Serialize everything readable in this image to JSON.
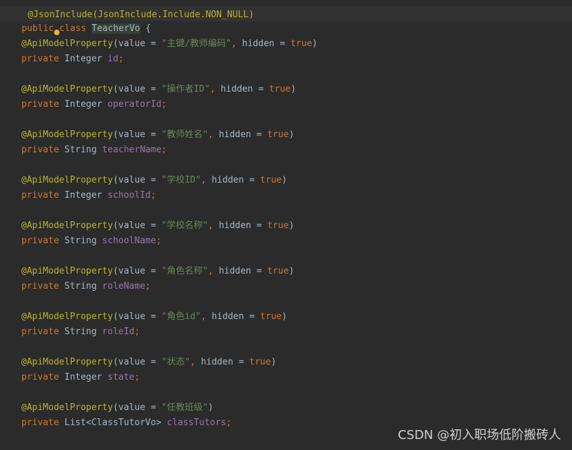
{
  "editor": {
    "top_partial": "@JsonInclude(JsonInclude.Include.NON_NULL)",
    "class_line": {
      "modifiers": "public class ",
      "class_name": "TeacherVo",
      "brace": " {"
    },
    "fields": [
      {
        "annotation": "@ApiModelProperty",
        "value_key": "(value = ",
        "value": "\"主键/教师编码\"",
        "hidden_part": ", hidden = ",
        "hidden": "true",
        "close": ")",
        "modifier": "private ",
        "type": "Integer",
        "name": "id"
      },
      {
        "annotation": "@ApiModelProperty",
        "value_key": "(value = ",
        "value": "\"操作者ID\"",
        "hidden_part": ", hidden = ",
        "hidden": "true",
        "close": ")",
        "modifier": "private ",
        "type": "Integer",
        "name": "operatorId"
      },
      {
        "annotation": "@ApiModelProperty",
        "value_key": "(value = ",
        "value": "\"教师姓名\"",
        "hidden_part": ", hidden = ",
        "hidden": "true",
        "close": ")",
        "modifier": "private ",
        "type": "String",
        "name": "teacherName"
      },
      {
        "annotation": "@ApiModelProperty",
        "value_key": "(value = ",
        "value": "\"学校ID\"",
        "hidden_part": ", hidden = ",
        "hidden": "true",
        "close": ")",
        "modifier": "private ",
        "type": "Integer",
        "name": "schoolId"
      },
      {
        "annotation": "@ApiModelProperty",
        "value_key": "(value = ",
        "value": "\"学校名称\"",
        "hidden_part": ", hidden = ",
        "hidden": "true",
        "close": ")",
        "modifier": "private ",
        "type": "String",
        "name": "schoolName"
      },
      {
        "annotation": "@ApiModelProperty",
        "value_key": "(value = ",
        "value": "\"角色名称\"",
        "hidden_part": ", hidden = ",
        "hidden": "true",
        "close": ")",
        "modifier": "private ",
        "type": "String",
        "name": "roleName"
      },
      {
        "annotation": "@ApiModelProperty",
        "value_key": "(value = ",
        "value": "\"角色id\"",
        "hidden_part": ", hidden = ",
        "hidden": "true",
        "close": ")",
        "modifier": "private ",
        "type": "String",
        "name": "roleId"
      },
      {
        "annotation": "@ApiModelProperty",
        "value_key": "(value = ",
        "value": "\"状态\"",
        "hidden_part": ", hidden = ",
        "hidden": "true",
        "close": ")",
        "modifier": "private ",
        "type": "Integer",
        "name": "state"
      },
      {
        "annotation": "@ApiModelProperty",
        "value_key": "(value = ",
        "value": "\"任教班级\"",
        "hidden_part": "",
        "hidden": "",
        "close": ")",
        "modifier": "private ",
        "type": "List<ClassTutorVo>",
        "name": "classTutors"
      }
    ],
    "semicolon": ";"
  },
  "watermark": "CSDN @初入职场低阶搬砖人",
  "colors": {
    "background": "#2b2b2b",
    "keyword": "#cc7832",
    "annotation": "#bbb529",
    "string": "#6a8759",
    "field": "#9876aa",
    "text": "#a9b7c6"
  }
}
